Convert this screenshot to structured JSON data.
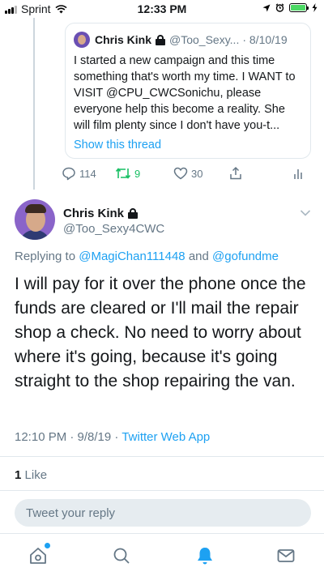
{
  "status_bar": {
    "carrier": "Sprint",
    "time": "12:33 PM"
  },
  "quoted_tweet": {
    "name": "Chris Kink",
    "handle": "@Too_Sexy...",
    "date": "· 8/10/19",
    "text": "I started a new campaign and this time something that's worth my time. I WANT to VISIT @CPU_CWCSonichu, please everyone help this become a reality. She will film plenty since I don't have you-t...",
    "show_thread_label": "Show this thread"
  },
  "previous_actions": {
    "reply_count": "114",
    "retweet_count": "9",
    "like_count": "30"
  },
  "tweet": {
    "name": "Chris Kink",
    "handle": "@Too_Sexy4CWC",
    "replying_prefix": "Replying to",
    "mention_1": "@MagiChan111448",
    "and_word": "and",
    "mention_2": "@gofundme",
    "text": "I will pay for it over the phone once the funds are cleared or I'll mail the repair shop a check. No need to worry about where it's going, because it's going straight to the shop repairing the van.",
    "time": "12:10 PM · 9/8/19 ·",
    "source": "Twitter Web App",
    "likes_count": "1",
    "likes_label": "Like"
  },
  "reply": {
    "placeholder": "Tweet your reply"
  },
  "tab_bar": {
    "items": [
      "home-icon",
      "search-icon",
      "notifications-icon",
      "messages-icon"
    ],
    "active": "notifications-icon"
  },
  "colors": {
    "accent": "#1da1f2",
    "retweet": "#17bf63",
    "muted": "#657786",
    "text": "#14171a"
  }
}
